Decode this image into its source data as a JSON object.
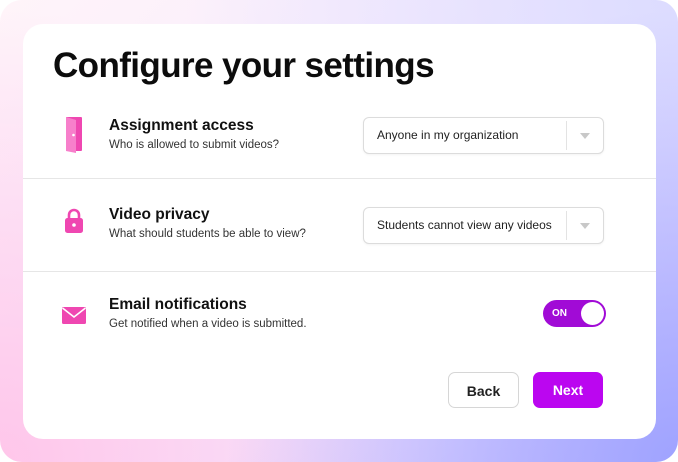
{
  "title": "Configure your settings",
  "colors": {
    "accent": "#bb06f0",
    "icon": "#ef47b1",
    "toggle": "#a10bd6"
  },
  "settings": [
    {
      "icon": "door-icon",
      "title": "Assignment access",
      "subtitle": "Who is allowed to submit videos?",
      "control": "select",
      "value": "Anyone in my organization"
    },
    {
      "icon": "lock-icon",
      "title": "Video privacy",
      "subtitle": "What should students be able to view?",
      "control": "select",
      "value": "Students cannot view any videos"
    },
    {
      "icon": "mail-icon",
      "title": "Email notifications",
      "subtitle": "Get notified when a video is submitted.",
      "control": "toggle",
      "value": "ON",
      "enabled": true
    }
  ],
  "buttons": {
    "back": "Back",
    "next": "Next"
  }
}
